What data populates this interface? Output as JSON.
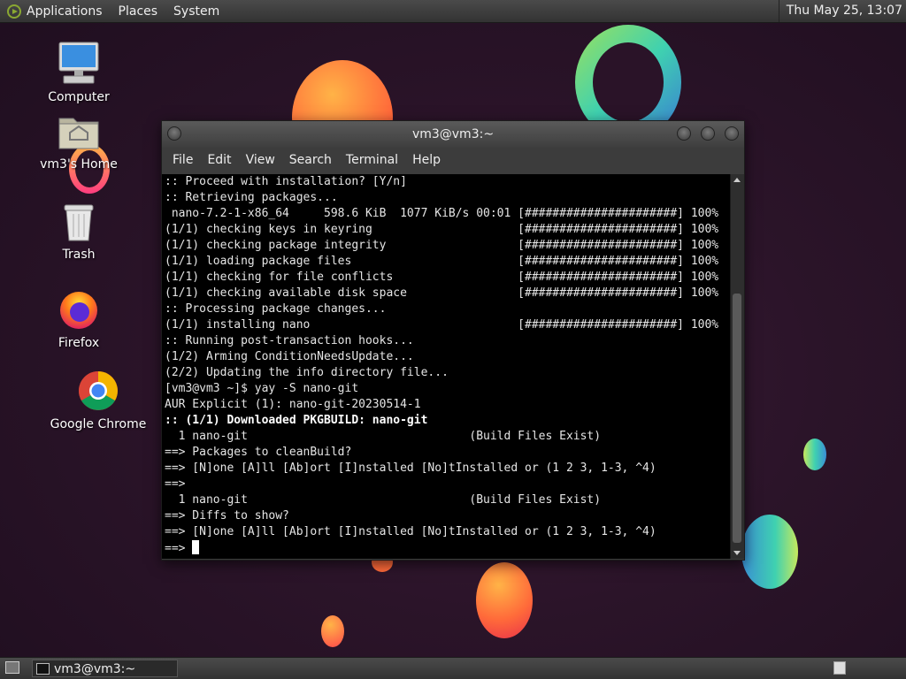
{
  "top_panel": {
    "menus": [
      "Applications",
      "Places",
      "System"
    ],
    "clock": "Thu May 25, 13:07"
  },
  "desktop_icons": [
    {
      "label": "Computer",
      "icon": "computer-icon"
    },
    {
      "label": "vm3's Home",
      "icon": "home-folder-icon"
    },
    {
      "label": "Trash",
      "icon": "trash-icon"
    },
    {
      "label": "Firefox",
      "icon": "firefox-icon"
    },
    {
      "label": "Google Chrome",
      "icon": "chrome-icon"
    }
  ],
  "window": {
    "title": "vm3@vm3:~",
    "menu": [
      "File",
      "Edit",
      "View",
      "Search",
      "Terminal",
      "Help"
    ]
  },
  "terminal": {
    "lines": [
      ":: Proceed with installation? [Y/n]",
      ":: Retrieving packages...",
      " nano-7.2-1-x86_64     598.6 KiB  1077 KiB/s 00:01 [######################] 100%",
      "(1/1) checking keys in keyring                     [######################] 100%",
      "(1/1) checking package integrity                   [######################] 100%",
      "(1/1) loading package files                        [######################] 100%",
      "(1/1) checking for file conflicts                  [######################] 100%",
      "(1/1) checking available disk space                [######################] 100%",
      ":: Processing package changes...",
      "(1/1) installing nano                              [######################] 100%",
      ":: Running post-transaction hooks...",
      "(1/2) Arming ConditionNeedsUpdate...",
      "(2/2) Updating the info directory file...",
      "[vm3@vm3 ~]$ yay -S nano-git",
      "AUR Explicit (1): nano-git-20230514-1",
      ":: (1/1) Downloaded PKGBUILD: nano-git",
      "  1 nano-git                                (Build Files Exist)",
      "==> Packages to cleanBuild?",
      "==> [N]one [A]ll [Ab]ort [I]nstalled [No]tInstalled or (1 2 3, 1-3, ^4)",
      "==>",
      "  1 nano-git                                (Build Files Exist)",
      "==> Diffs to show?",
      "==> [N]one [A]ll [Ab]ort [I]nstalled [No]tInstalled or (1 2 3, 1-3, ^4)"
    ],
    "prompt": "==> "
  },
  "taskbar": {
    "task_label": "vm3@vm3:~"
  }
}
